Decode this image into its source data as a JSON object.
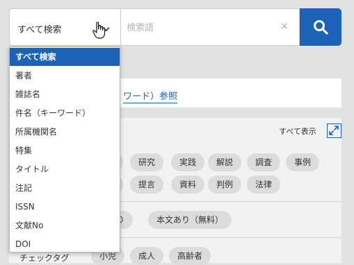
{
  "search": {
    "scope_label": "すべて検索",
    "keyword_placeholder": "検索語",
    "keyword_value": "",
    "clear_glyph": "×"
  },
  "scope_options": [
    "すべて検索",
    "著者",
    "雑誌名",
    "件名（キーワード）",
    "所属機関名",
    "特集",
    "タイトル",
    "注記",
    "ISSN",
    "文献No",
    "DOI"
  ],
  "selected_scope": "すべて検索",
  "panel": {
    "reference_link": "ワード）参照",
    "show_all": "すべて表示",
    "chips_row1": [
      "研究",
      "実践",
      "解説",
      "調査",
      "事例"
    ],
    "chips_row2": [
      "提言",
      "資料",
      "判例",
      "法律"
    ],
    "chips_row3": [
      "あり",
      "本文あり（無料）"
    ],
    "check_tag_label": "チェックタグ",
    "chips_row4": [
      "小児",
      "成人",
      "高齢者"
    ]
  },
  "colors": {
    "accent": "#1c63b8",
    "chip_bg": "#dcdcdc"
  },
  "icons": [
    "chevron-down-icon",
    "pointer-cursor-icon",
    "clear-icon",
    "search-icon",
    "expand-icon"
  ]
}
